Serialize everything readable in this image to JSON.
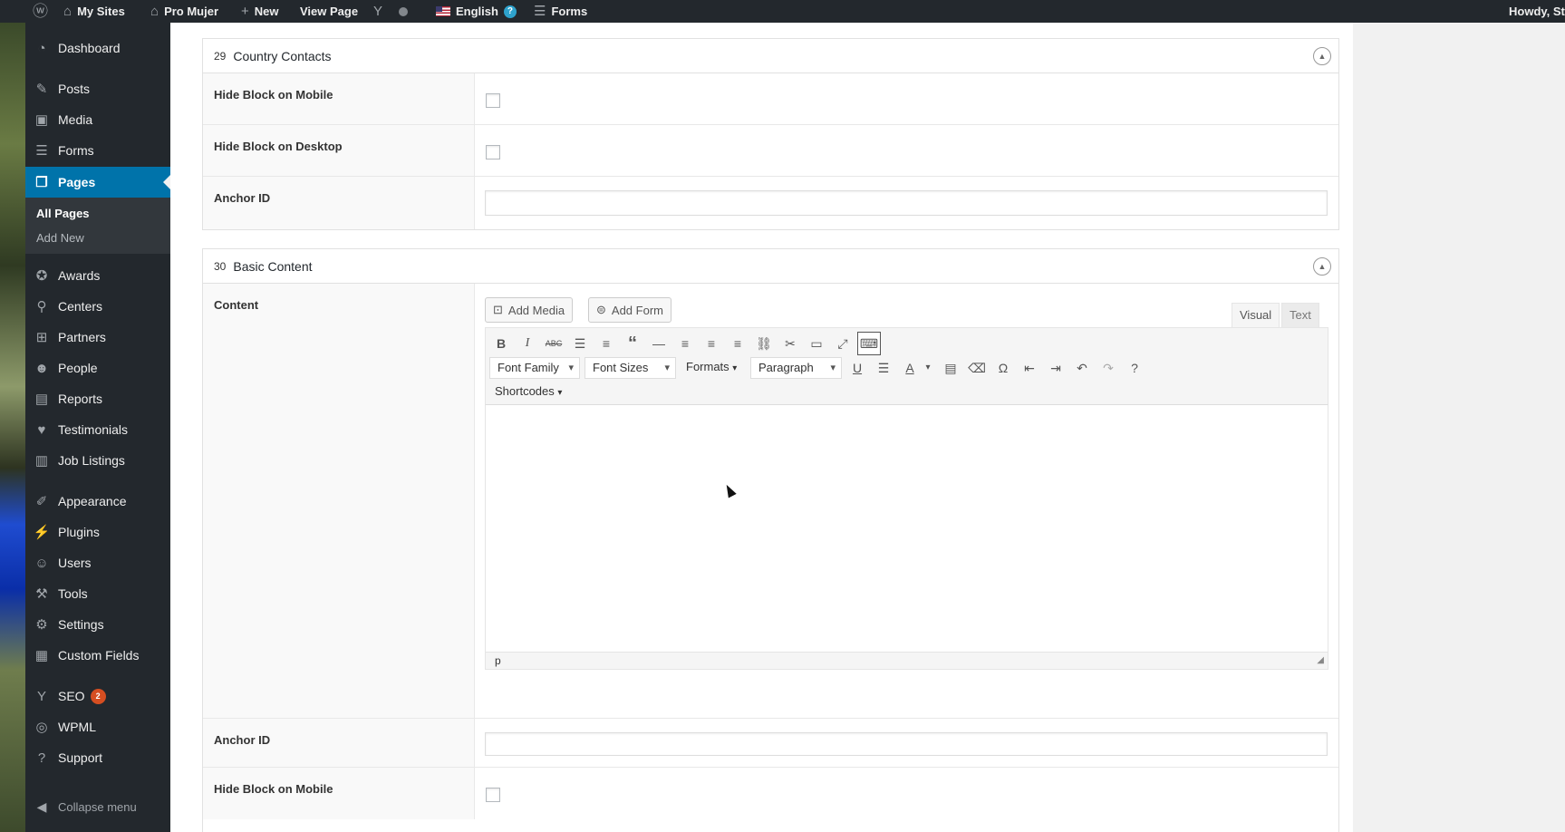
{
  "adminbar": {
    "my_sites": "My Sites",
    "site_name": "Pro Mujer",
    "new": "New",
    "view_page": "View Page",
    "language": "English",
    "forms": "Forms",
    "howdy": "Howdy, St"
  },
  "sidebar": {
    "items": [
      {
        "label": "Dashboard",
        "icon": "dashboard-icon"
      },
      {
        "label": "Posts",
        "icon": "pin-icon"
      },
      {
        "label": "Media",
        "icon": "media-icon"
      },
      {
        "label": "Forms",
        "icon": "forms-icon"
      },
      {
        "label": "Pages",
        "icon": "pages-icon"
      },
      {
        "label": "Awards",
        "icon": "award-icon"
      },
      {
        "label": "Centers",
        "icon": "location-icon"
      },
      {
        "label": "Partners",
        "icon": "sitemap-icon"
      },
      {
        "label": "People",
        "icon": "people-icon"
      },
      {
        "label": "Reports",
        "icon": "document-icon"
      },
      {
        "label": "Testimonials",
        "icon": "heart-icon"
      },
      {
        "label": "Job Listings",
        "icon": "briefcase-icon"
      },
      {
        "label": "Appearance",
        "icon": "brush-icon"
      },
      {
        "label": "Plugins",
        "icon": "plugin-icon"
      },
      {
        "label": "Users",
        "icon": "user-icon"
      },
      {
        "label": "Tools",
        "icon": "wrench-icon"
      },
      {
        "label": "Settings",
        "icon": "settings-icon"
      },
      {
        "label": "Custom Fields",
        "icon": "table-icon"
      },
      {
        "label": "SEO",
        "icon": "yoast-icon",
        "badge": "2"
      },
      {
        "label": "WPML",
        "icon": "wpml-icon"
      },
      {
        "label": "Support",
        "icon": "help-icon"
      }
    ],
    "submenu": [
      "All Pages",
      "Add New"
    ],
    "collapse": "Collapse menu"
  },
  "block29": {
    "number": "29",
    "title": "Country Contacts",
    "hide_mobile": "Hide Block on Mobile",
    "hide_desktop": "Hide Block on Desktop",
    "anchor": "Anchor ID"
  },
  "block30": {
    "number": "30",
    "title": "Basic Content",
    "content_label": "Content",
    "add_media": "Add Media",
    "add_form": "Add Form",
    "tab_visual": "Visual",
    "tab_text": "Text",
    "font_family": "Font Family",
    "font_sizes": "Font Sizes",
    "formats": "Formats",
    "paragraph": "Paragraph",
    "shortcodes": "Shortcodes",
    "status_path": "p",
    "anchor": "Anchor ID",
    "hide_mobile": "Hide Block on Mobile"
  },
  "colors": {
    "admin_bg": "#23282d",
    "accent": "#0073aa",
    "badge": "#d54e21"
  }
}
